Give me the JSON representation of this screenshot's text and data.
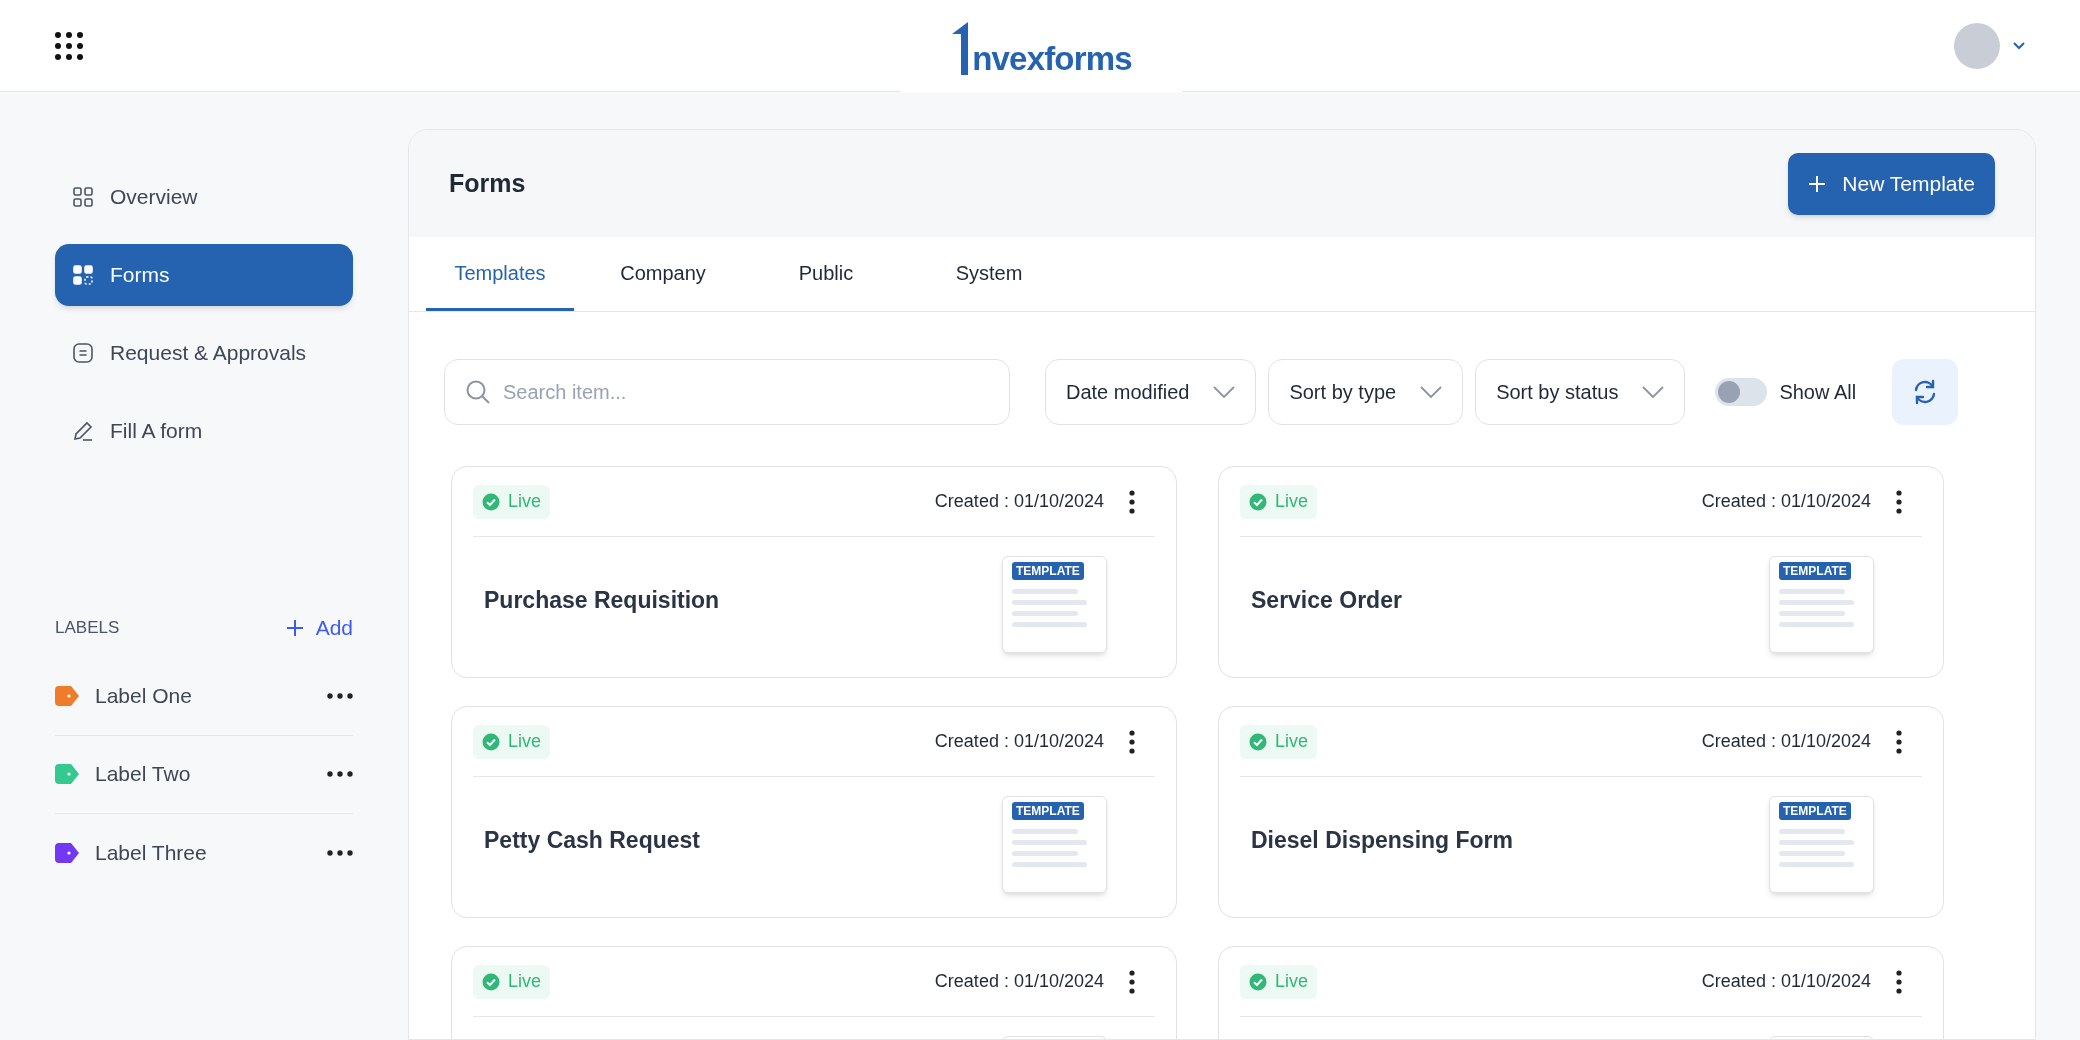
{
  "header": {
    "logo_text": "nvexforms"
  },
  "sidebar": {
    "items": [
      {
        "label": "Overview",
        "selected": false
      },
      {
        "label": "Forms",
        "selected": true
      },
      {
        "label": "Request & Approvals",
        "selected": false
      },
      {
        "label": "Fill A form",
        "selected": false
      }
    ],
    "labels_heading": "LABELS",
    "add_label": "Add",
    "labels": [
      {
        "label": "Label One",
        "color": "#f07b2b"
      },
      {
        "label": "Label Two",
        "color": "#34c98e"
      },
      {
        "label": "Label Three",
        "color": "#7338f2"
      }
    ]
  },
  "main": {
    "title": "Forms",
    "new_button": "New Template",
    "tabs": [
      {
        "label": "Templates",
        "selected": true
      },
      {
        "label": "Company",
        "selected": false
      },
      {
        "label": "Public",
        "selected": false
      },
      {
        "label": "System",
        "selected": false
      }
    ],
    "search": {
      "placeholder": "Search item..."
    },
    "filters": [
      "Date modified",
      "Sort by type",
      "Sort by status"
    ],
    "show_all": {
      "label": "Show All",
      "on": false
    },
    "cards": [
      {
        "status": "Live",
        "created": "Created : 01/10/2024",
        "title": "Purchase Requisition",
        "thumb_badge": "TEMPLATE"
      },
      {
        "status": "Live",
        "created": "Created : 01/10/2024",
        "title": "Service Order",
        "thumb_badge": "TEMPLATE"
      },
      {
        "status": "Live",
        "created": "Created : 01/10/2024",
        "title": "Petty Cash Request",
        "thumb_badge": "TEMPLATE"
      },
      {
        "status": "Live",
        "created": "Created : 01/10/2024",
        "title": "Diesel Dispensing Form",
        "thumb_badge": "TEMPLATE"
      },
      {
        "status": "Live",
        "created": "Created : 01/10/2024"
      },
      {
        "status": "Live",
        "created": "Created : 01/10/2024"
      }
    ]
  }
}
